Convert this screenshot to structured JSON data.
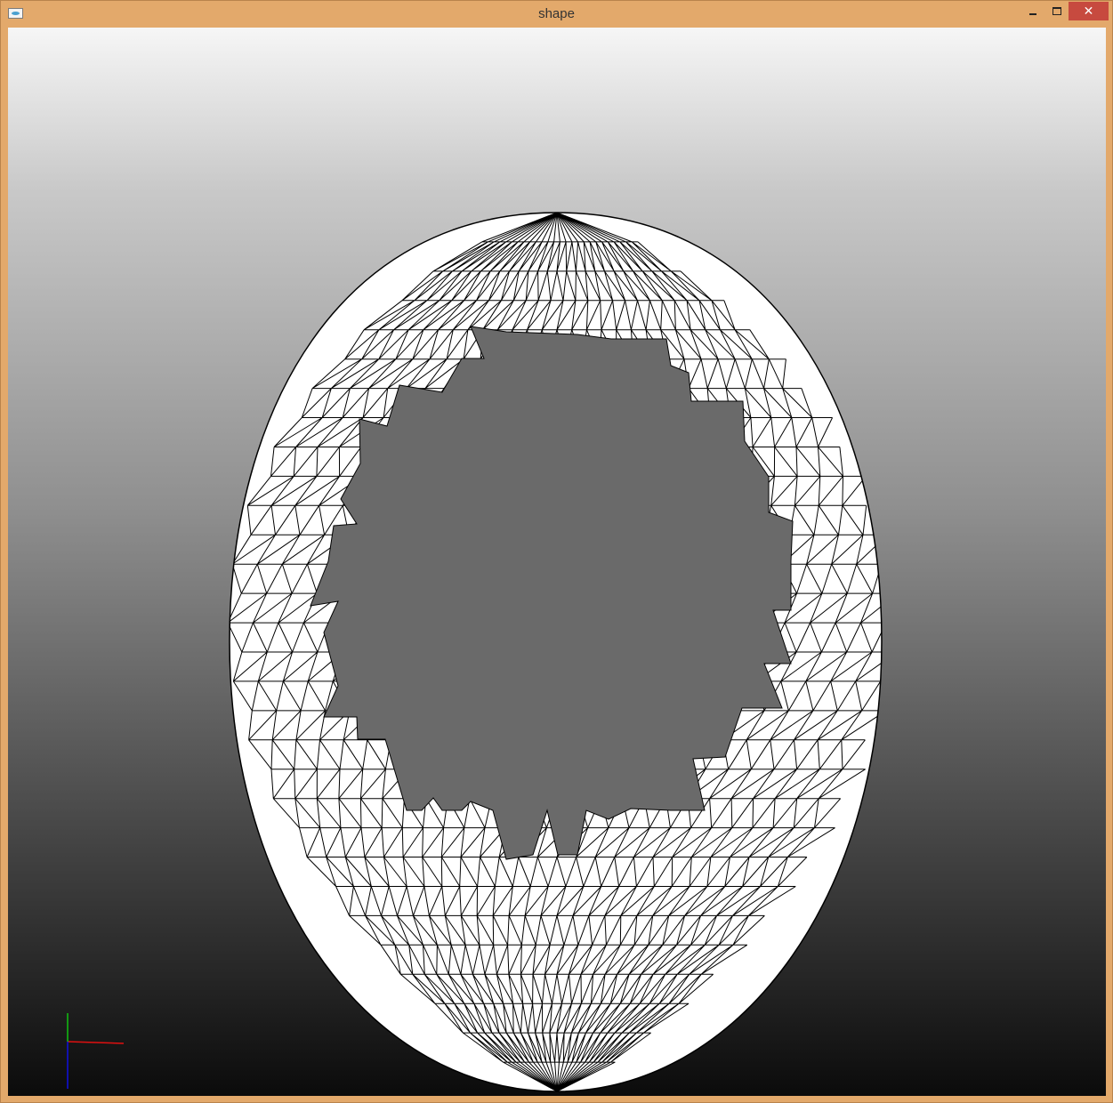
{
  "window": {
    "title": "shape"
  },
  "icons": {
    "app": "app-icon",
    "minimize": "minimize-icon",
    "maximize": "maximize-icon",
    "close": "close-icon"
  },
  "colors": {
    "frame": "#e3a96b",
    "close_button": "#c74a3f",
    "mesh_fill": "#ffffff",
    "mesh_edges": "#000000",
    "axis_x": "#e01010",
    "axis_y": "#10c010",
    "axis_z": "#1010e0"
  },
  "close_glyph": "✕"
}
